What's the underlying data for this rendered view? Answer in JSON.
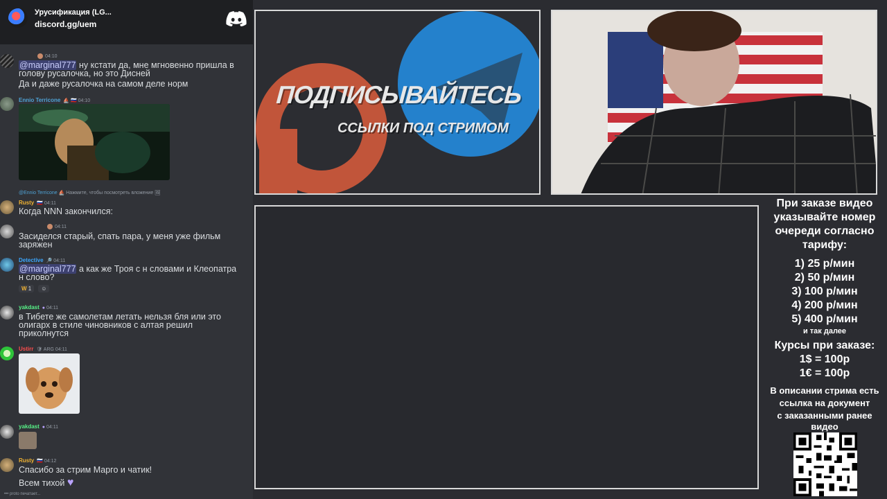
{
  "server": {
    "name": "Урусификация (LG...",
    "invite": "discord.gg/uem"
  },
  "messages": {
    "m1": {
      "time": "04:10",
      "line1_mention": "@marginal777",
      "line1_rest": " ну кстати да, мне мгновенно пришла в",
      "line2": "голову русалочка, но это Дисней",
      "line3": "Да и даже русалочка на самом деле норм"
    },
    "m2": {
      "name": "Ennio Terricone",
      "badges": "⛵ 🇷🇺",
      "time": "04:10"
    },
    "m3": {
      "reply_name": "@Ennio Terricone",
      "reply_text": "⛵ Нажмите, чтобы посмотреть вложение 🖼",
      "name": "Rusty",
      "badges": "🇷🇺",
      "time": "04:11",
      "text": "Когда NNN закончился:"
    },
    "m4": {
      "time": "04:11",
      "line1": "Засиделся старый, спать пара, у меня уже фильм",
      "line2": "заряжен"
    },
    "m5": {
      "name": "Detective",
      "time": "04:11",
      "line1_mention": "@marginal777",
      "line1_rest": " а как же Троя с н словами и Клеопатра",
      "line2": "н слово?",
      "reaction_count": "1"
    },
    "m6": {
      "name": "yakdast",
      "time": "04:11",
      "line1": "в Тибете же самолетам летать нельзя бля или это",
      "line2": "олигарх в стиле чиновников с алтая решил",
      "line3": "приколнутся"
    },
    "m7": {
      "name": "Ustirr",
      "badges": "🛡 ARG",
      "time": "04:11"
    },
    "m8": {
      "name": "yakdast",
      "time": "04:11"
    },
    "m9": {
      "name": "Rusty",
      "badges": "🇷🇺",
      "time": "04:12",
      "line1": "Спасибо за стрим Марго и чатик!",
      "line2": "Всем тихой"
    },
    "typing": "proto печатает..."
  },
  "banner": {
    "title": "ПОДПИСЫВАЙТЕСЬ",
    "subtitle": "ССЫЛКИ ПОД СТРИМОМ"
  },
  "order": {
    "heading": [
      "При заказе видео",
      "указывайте номер",
      "очереди согласно",
      "тарифу:"
    ],
    "tariffs": [
      "1) 25 р/мин",
      "2) 50 р/мин",
      "3) 100 р/мин",
      "4) 200 р/мин",
      "5) 400 р/мин"
    ],
    "etc": "и так далее",
    "rates_title": "Курсы при заказе:",
    "rates": [
      "1$ = 100р",
      "1€ = 100р"
    ],
    "note": [
      "В описании стрима есть",
      "ссылка на документ",
      "с заказанными ранее",
      "видео"
    ]
  },
  "colors": {
    "chat_bg": "#313338",
    "header_bg": "#1e1f22",
    "mention_bg": "#3c4270",
    "rusty_name": "#f0b232",
    "detective_name": "#3ba7ff",
    "yakdast_name": "#57f287",
    "ustirr_name": "#ff4d4d",
    "ennio_name": "#4fa3d6"
  }
}
